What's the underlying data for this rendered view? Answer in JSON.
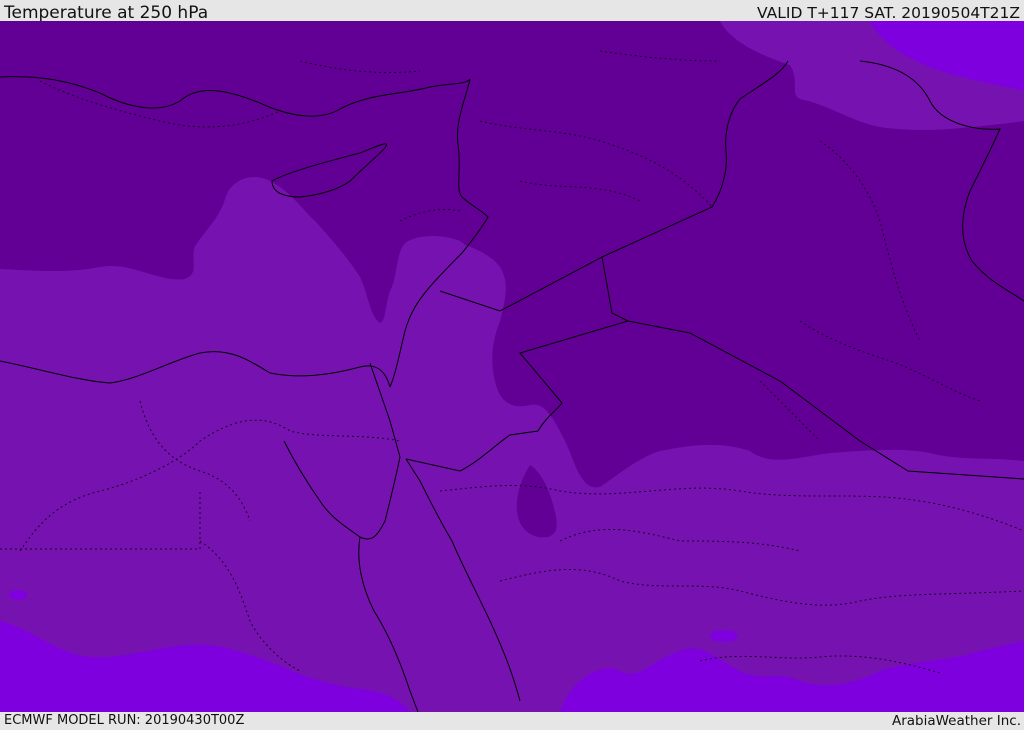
{
  "header": {
    "title": "Temperature at 250 hPa",
    "valid_time": "VALID T+117 SAT. 20190504T21Z"
  },
  "footer": {
    "model_run": "ECMWF MODEL RUN: 20190430T00Z",
    "credit": "ArabiaWeather Inc."
  },
  "colors": {
    "coldest": "#620095",
    "mid": "#7613b0",
    "warm": "#7f00de",
    "border": "#000000",
    "header_bg": "#e6e6e6"
  }
}
